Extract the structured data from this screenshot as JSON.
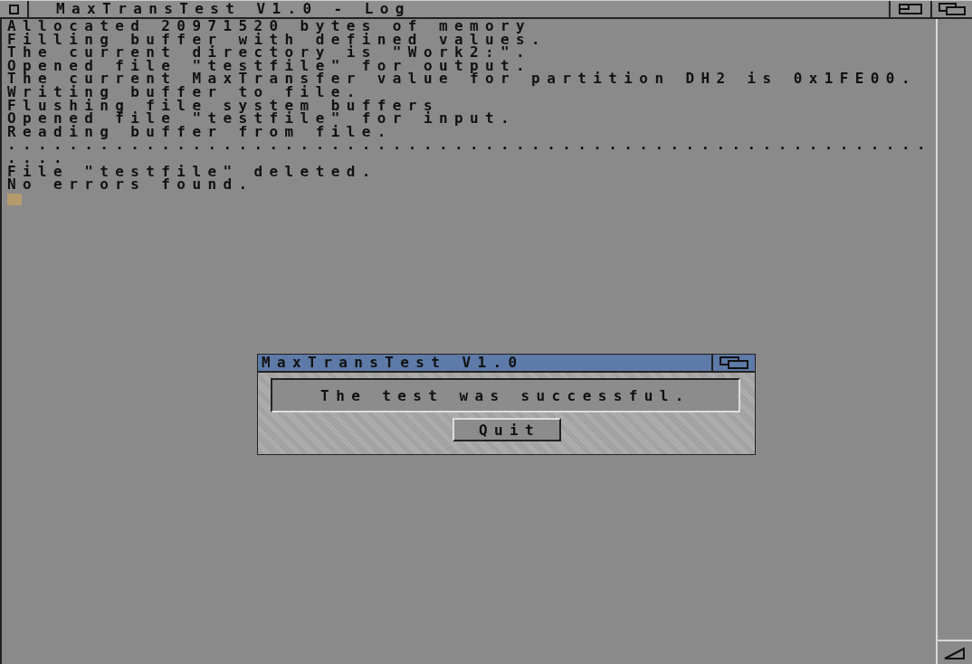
{
  "window": {
    "title": "MaxTransTest V1.0 - Log"
  },
  "log_lines": [
    "Allocated 20971520 bytes of memory",
    "Filling buffer with defined values.",
    "The current directory is \"Work2:\".",
    "Opened file \"testfile\" for output.",
    "The current MaxTransfer value for partition DH2 is 0x1FE00.",
    "Writing buffer to file.",
    "Flushing file system buffers",
    "Opened file \"testfile\" for input.",
    "Reading buffer from file.",
    "............................................................",
    "....",
    "File \"testfile\" deleted.",
    "No errors found."
  ],
  "dialog": {
    "title": "MaxTransTest V1.0",
    "message": "The test was successful.",
    "buttons": [
      "Quit"
    ]
  }
}
